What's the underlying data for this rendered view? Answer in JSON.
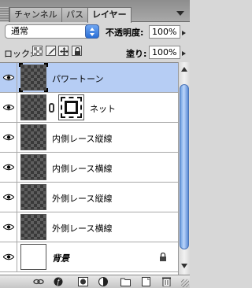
{
  "tabs": [
    {
      "label": "チャンネル",
      "active": false
    },
    {
      "label": "パス",
      "active": false
    },
    {
      "label": "レイヤー",
      "active": true
    }
  ],
  "options": {
    "blend_mode": "通常",
    "opacity_label": "不透明度:",
    "opacity_value": "100%",
    "lock_label": "ロック:",
    "fill_label": "塗り:",
    "fill_value": "100%"
  },
  "layers": [
    {
      "name": "パワートーン",
      "visible": true,
      "selected": true,
      "thumbnail": "checker"
    },
    {
      "name": "ネット",
      "visible": true,
      "selected": false,
      "thumbnail": "checker",
      "has_mask": true
    },
    {
      "name": "内側レース縦線",
      "visible": true,
      "selected": false,
      "thumbnail": "checker"
    },
    {
      "name": "内側レース横線",
      "visible": true,
      "selected": false,
      "thumbnail": "checker"
    },
    {
      "name": "外側レース縦線",
      "visible": true,
      "selected": false,
      "thumbnail": "checker"
    },
    {
      "name": "外側レース横線",
      "visible": true,
      "selected": false,
      "thumbnail": "checker"
    },
    {
      "name": "背景",
      "visible": true,
      "selected": false,
      "thumbnail": "white",
      "locked": true
    }
  ],
  "toolbar_icons": [
    "link-layers-icon",
    "layer-style-icon",
    "layer-mask-icon",
    "adjustment-layer-icon",
    "new-group-icon",
    "new-layer-icon",
    "trash-icon"
  ],
  "colors": {
    "selection": "#b6cdf4",
    "accent": "#2a6fd6"
  }
}
